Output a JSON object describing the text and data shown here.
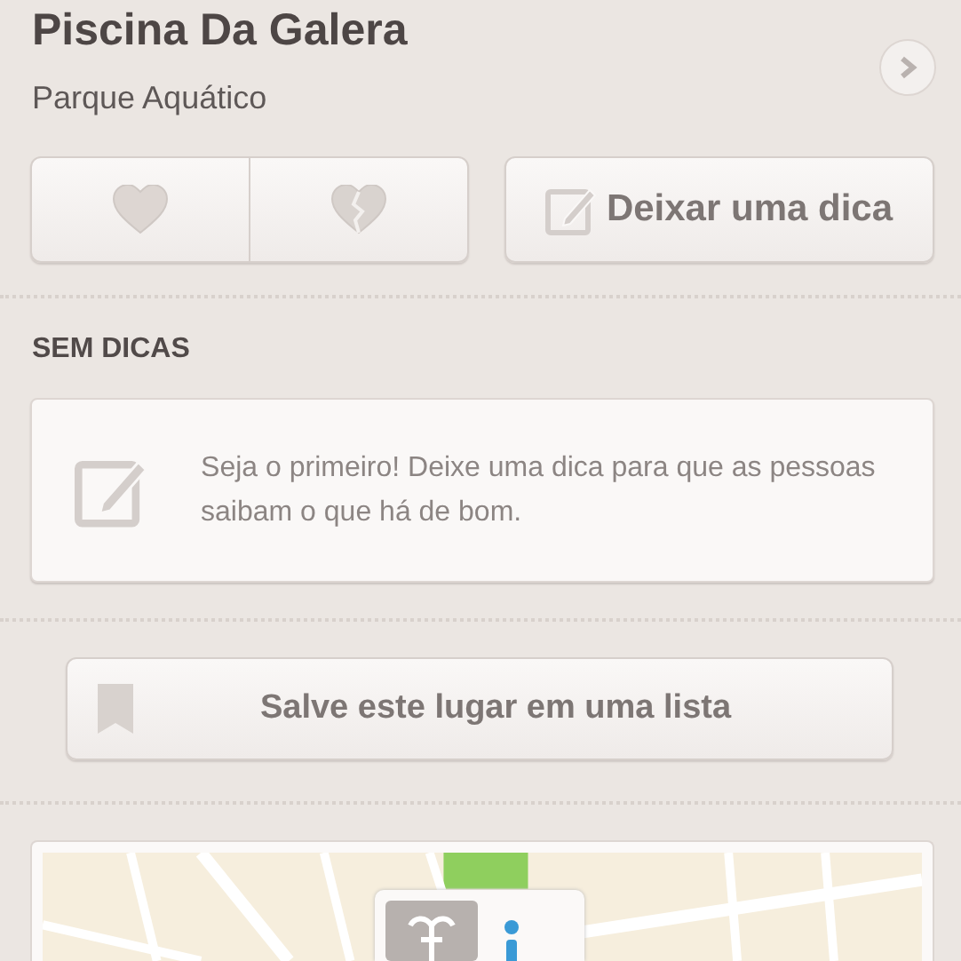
{
  "venue": {
    "title": "Piscina Da Galera",
    "category": "Parque Aquático"
  },
  "actions": {
    "like_selected": false,
    "dislike_selected": false,
    "tip_button": "Deixar uma dica"
  },
  "tips": {
    "heading": "SEM DICAS",
    "empty_message": "Seja o primeiro! Deixe uma dica para que as pessoas saibam o que há de bom."
  },
  "save_button": "Salve este lugar em uma lista"
}
